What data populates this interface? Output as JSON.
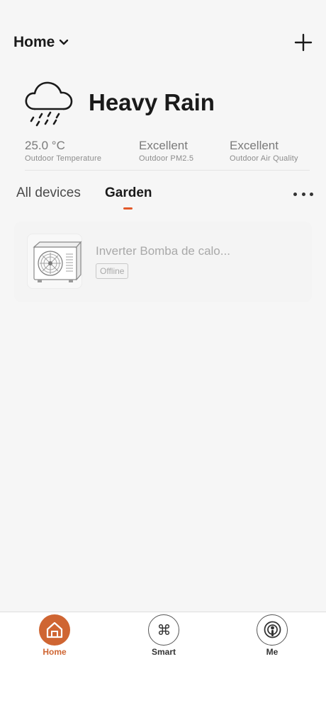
{
  "header": {
    "home_label": "Home",
    "add_icon": "plus-icon"
  },
  "weather": {
    "condition": "Heavy Rain",
    "icon": "rain-cloud-icon",
    "metrics": [
      {
        "value": "25.0 °C",
        "label": "Outdoor Temperature"
      },
      {
        "value": "Excellent",
        "label": "Outdoor PM2.5"
      },
      {
        "value": "Excellent",
        "label": "Outdoor Air Quality"
      }
    ]
  },
  "rooms": {
    "tabs": [
      {
        "label": "All devices",
        "selected": false
      },
      {
        "label": "Garden",
        "selected": true
      }
    ],
    "more_icon": "more-dots-icon"
  },
  "devices": [
    {
      "name": "Inverter Bomba de calo...",
      "status": "Offline",
      "icon": "heat-pump-icon"
    }
  ],
  "tabbar": {
    "items": [
      {
        "label": "Home",
        "icon": "home-icon",
        "active": true
      },
      {
        "label": "Smart",
        "icon": "command-icon",
        "active": false
      },
      {
        "label": "Me",
        "icon": "profile-icon",
        "active": false
      }
    ]
  },
  "colors": {
    "accent": "#cf6532",
    "tab_indicator": "#e2592a",
    "background": "#f6f6f6"
  }
}
